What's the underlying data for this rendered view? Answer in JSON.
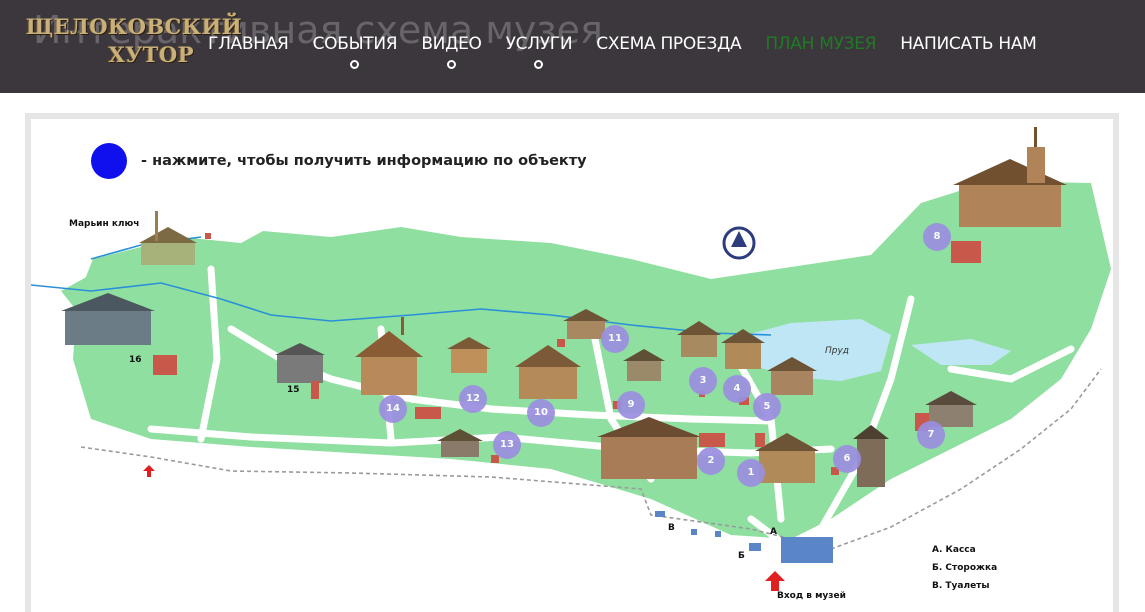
{
  "page": {
    "ghost_title": "Интерактивная схема музея"
  },
  "logo": {
    "line1": "ЩЕЛОКОВСКИЙ",
    "line2": "ХУТОР"
  },
  "nav": {
    "items": [
      {
        "label": "ГЛАВНАЯ",
        "has_submenu": false,
        "active": false
      },
      {
        "label": "СОБЫТИЯ",
        "has_submenu": true,
        "active": false
      },
      {
        "label": "ВИДЕО",
        "has_submenu": true,
        "active": false
      },
      {
        "label": "УСЛУГИ",
        "has_submenu": true,
        "active": false
      },
      {
        "label": "СХЕМА ПРОЕЗДА",
        "has_submenu": false,
        "active": false
      },
      {
        "label": "ПЛАН МУЗЕЯ",
        "has_submenu": false,
        "active": true
      },
      {
        "label": "НАПИСАТЬ НАМ",
        "has_submenu": false,
        "active": false
      }
    ],
    "active_color": "#1e7b23"
  },
  "map": {
    "legend": {
      "text": "- нажмите, чтобы получить информацию по объекту",
      "dot_color": "#1010ee"
    },
    "labels": {
      "spring": "Марьин ключ",
      "pond": "Пруд",
      "n15": "15",
      "n16": "16",
      "gate_a": "А",
      "gate_b": "Б",
      "gate_v": "В",
      "entrance": "Вход в музей"
    },
    "markers": [
      "1",
      "2",
      "3",
      "4",
      "5",
      "6",
      "7",
      "8",
      "9",
      "10",
      "11",
      "12",
      "13",
      "14"
    ],
    "key": [
      "А. Касса",
      "Б. Сторожка",
      "В. Туалеты"
    ],
    "colors": {
      "grass": "#8fe0a0",
      "water": "#bfe6f5",
      "river": "#2a8fd8",
      "marker": "#9b8ee0",
      "building": "#c8584a"
    },
    "icons": [
      "compass-icon",
      "entrance-arrow-icon"
    ]
  }
}
